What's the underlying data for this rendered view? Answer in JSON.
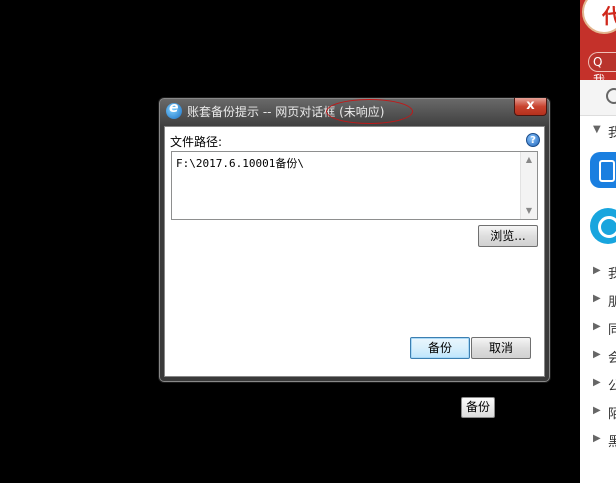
{
  "dialog": {
    "title": "账套备份提示 -- 网页对话框 (未响应)",
    "close_label": "x",
    "path_label": "文件路径:",
    "path_value": "F:\\2017.6.10001备份\\",
    "help_label": "?",
    "browse_label": "浏览...",
    "backup_label": "备份",
    "cancel_label": "取消",
    "scroll_up": "▲",
    "scroll_down": "▼"
  },
  "background_button": {
    "label": "备份"
  },
  "side_panel": {
    "top_char": "代",
    "search_char": "Q 我",
    "rows": [
      {
        "label": "我"
      },
      {
        "label": "朋"
      },
      {
        "label": "同"
      },
      {
        "label": "会"
      },
      {
        "label": "公"
      },
      {
        "label": "陌"
      },
      {
        "label": "黑"
      }
    ],
    "row_arrow": "▶",
    "collapse_arrow": "▼",
    "collapse_label": "我"
  },
  "colors": {
    "title_ellipse": "#c01818",
    "close_button": "#c8432f",
    "default_button_border": "#3c7fb1"
  }
}
